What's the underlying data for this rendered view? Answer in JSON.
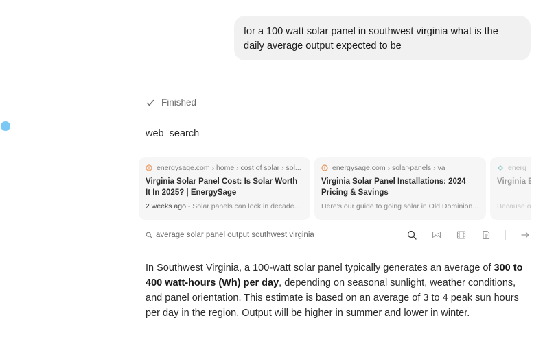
{
  "user_message": {
    "text": "for a 100 watt solar panel in southwest virginia what is the daily average output expected to be"
  },
  "status": {
    "label": "Finished"
  },
  "tool": {
    "name": "web_search"
  },
  "results": [
    {
      "source": "energysage.com › home › cost of solar › sol...",
      "title": "Virginia Solar Panel Cost: Is Solar Worth It In 2025? | EnergySage",
      "age": "2 weeks ago",
      "snippet": " - Solar panels can lock in decade...",
      "favicon_color": "#e8955a"
    },
    {
      "source": "energysage.com › solar-panels › va",
      "title": "Virginia Solar Panel Installations: 2024 Pricing & Savings",
      "age": "",
      "snippet": "Here's our guide to going solar in Old Dominion...",
      "favicon_color": "#e8955a"
    },
    {
      "source": "energ",
      "title": "Virginia E Energy",
      "age": "",
      "snippet": "Because o",
      "favicon_color": "#2a9d8f"
    }
  ],
  "query": {
    "text": "average solar panel output southwest virginia"
  },
  "answer": {
    "part1": "In Southwest Virginia, a 100-watt solar panel typically generates an average of ",
    "bold": "300 to 400 watt-hours (Wh) per day",
    "part2": ", depending on seasonal sunlight, weather conditions, and panel orientation. This estimate is based on an average of 3 to 4 peak sun hours per day in the region. Output will be higher in summer and lower in winter."
  }
}
